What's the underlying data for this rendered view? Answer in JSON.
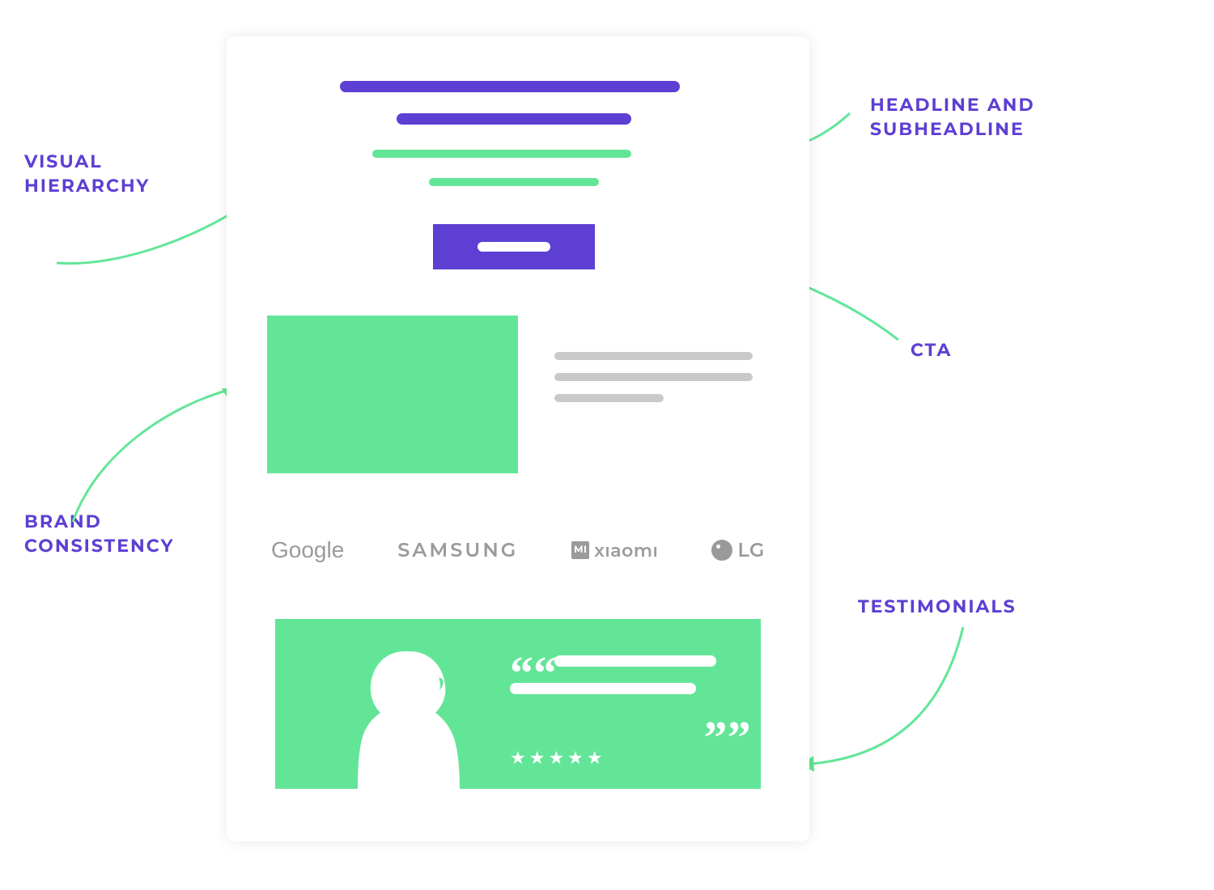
{
  "labels": {
    "visual_hierarchy": "VISUAL\nHIERARCHY",
    "brand_consistency": "BRAND\nCONSISTENCY",
    "headline_subheadline": "HEADLINE AND\nSUBHEADLINE",
    "cta": "CTA",
    "testimonials": "TESTIMONIALS"
  },
  "brands": {
    "google": "Google",
    "samsung": "SAMSUNG",
    "xiaomi_icon": "MI",
    "xiaomi": "xıaomı",
    "lg": "LG"
  },
  "testimonial": {
    "stars": "★★★★★",
    "quote_open": "““",
    "quote_close": "„„"
  },
  "colors": {
    "accent_purple": "#5d3fd3",
    "accent_green": "#63e598",
    "muted_gray": "#c9c9c9"
  }
}
